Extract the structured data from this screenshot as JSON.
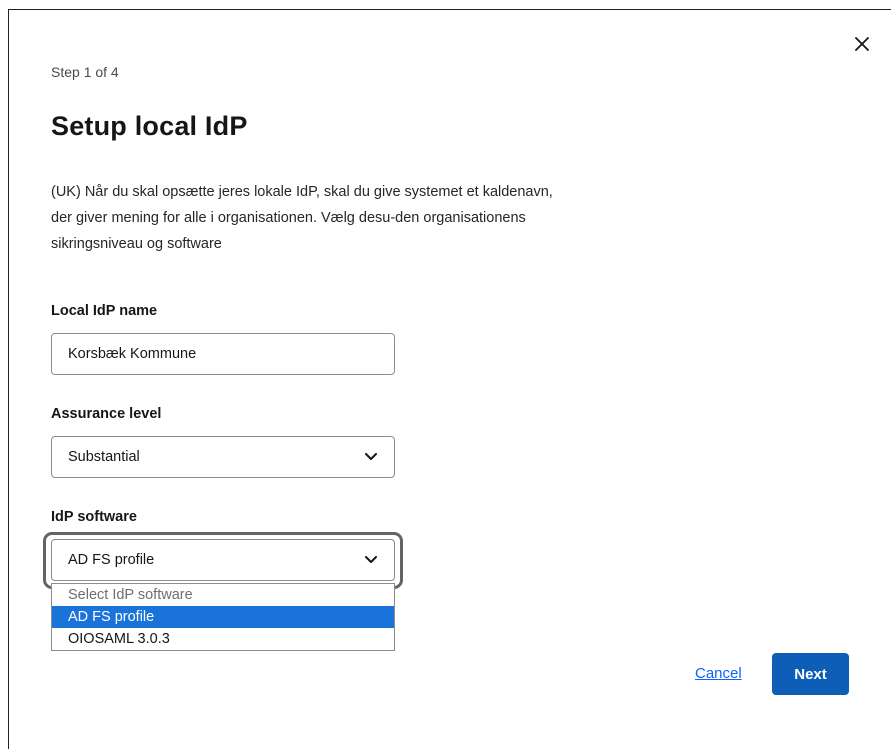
{
  "dialog": {
    "step": "Step 1 of 4",
    "title": "Setup local IdP",
    "description": "(UK) Når du skal opsætte jeres lokale IdP, skal du give systemet et kaldenavn, der giver mening for alle i organisationen. Vælg desu-den organisationens sikringsniveau og software"
  },
  "form": {
    "idp_name": {
      "label": "Local IdP name",
      "value": "Korsbæk Kommune"
    },
    "assurance": {
      "label": "Assurance level",
      "selected": "Substantial"
    },
    "software": {
      "label": "IdP software",
      "selected": "AD FS profile",
      "options": [
        "Select IdP software",
        "AD FS profile",
        "OIOSAML 3.0.3"
      ]
    }
  },
  "actions": {
    "cancel": "Cancel",
    "next": "Next"
  },
  "icons": {
    "close": "close-icon",
    "chevron": "chevron-down-icon"
  },
  "colors": {
    "primary": "#0e5eb8",
    "link": "#0f62fe",
    "highlight": "#1a73d9"
  }
}
